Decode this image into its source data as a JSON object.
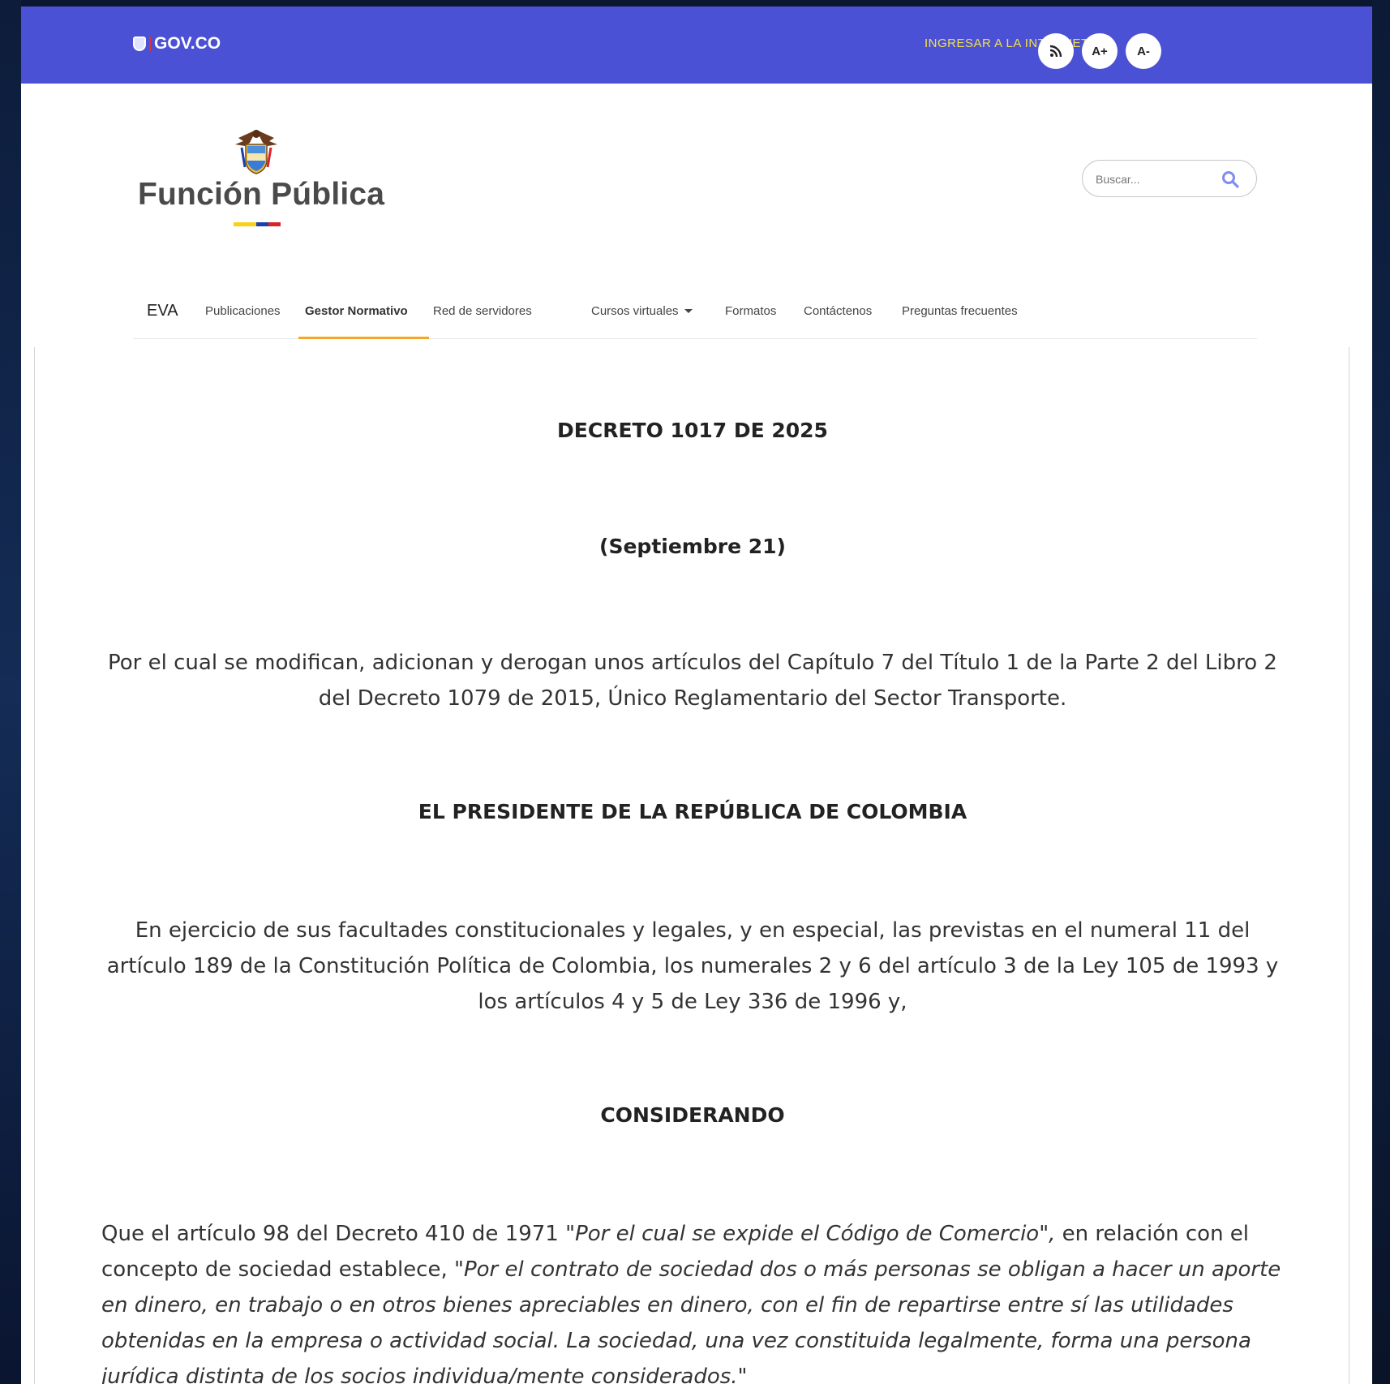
{
  "topbar": {
    "gov_logo": "GOV.CO",
    "intranet_link": "INGRESAR A LA INTRANET",
    "rss_icon": "rss-icon",
    "font_increase": "A+",
    "font_decrease": "A-"
  },
  "header": {
    "brand": "Función Pública",
    "emblem_icon": "colombia-coat-of-arms-icon",
    "search": {
      "placeholder": "Buscar...",
      "icon": "search-icon"
    }
  },
  "nav": {
    "items": [
      {
        "label": "EVA"
      },
      {
        "label": "Publicaciones"
      },
      {
        "label": "Gestor Normativo",
        "active": true
      },
      {
        "label": "Red de servidores"
      },
      {
        "label": "Cursos virtuales",
        "dropdown": true
      },
      {
        "label": "Formatos"
      },
      {
        "label": "Contáctenos"
      },
      {
        "label": "Preguntas frecuentes"
      }
    ]
  },
  "document": {
    "title": "DECRETO 1017 DE 2025",
    "date": "(Septiembre 21)",
    "summary": "Por el cual se modifican, adicionan y derogan unos artículos del Capítulo 7 del Título 1 de la Parte 2 del Libro 2 del Decreto 1079 de 2015, Único Reglamentario del Sector Transporte.",
    "authority": "EL PRESIDENTE DE LA REPÚBLICA DE COLOMBIA",
    "faculties": "En ejercicio de sus facultades constitucionales y legales, y en especial, las previstas en el numeral 11 del artículo 189 de la Constitución Política de Colombia, los numerales 2 y 6 del artículo 3 de la Ley 105 de 1993 y los artículos 4 y 5 de Ley 336 de 1996 y,",
    "considerando": "CONSIDERANDO",
    "para1_intro": "Que el artículo 98 del Decreto 410 de 1971 ",
    "para1_quote1": "\"Por el cual se expide el Código de Comercio\",",
    "para1_mid": " en relación con el concepto de sociedad establece, ",
    "para1_quote2": "\"Por el contrato de sociedad dos o más personas se obligan a hacer un aporte en dinero, en trabajo o en otros bienes apreciables en dinero, con el fin de repartirse entre sí las utilidades obtenidas en la empresa o actividad social. La sociedad, una vez constituida legalmente, forma una persona jurídica distinta de los socios individua/mente considerados.\""
  },
  "colors": {
    "topbar": "#4b51d4",
    "intranet": "#f2e04b",
    "active_underline": "#f5a623",
    "flag_yellow": "#f8d117",
    "flag_blue": "#1d3fa8",
    "flag_red": "#d8232a"
  }
}
